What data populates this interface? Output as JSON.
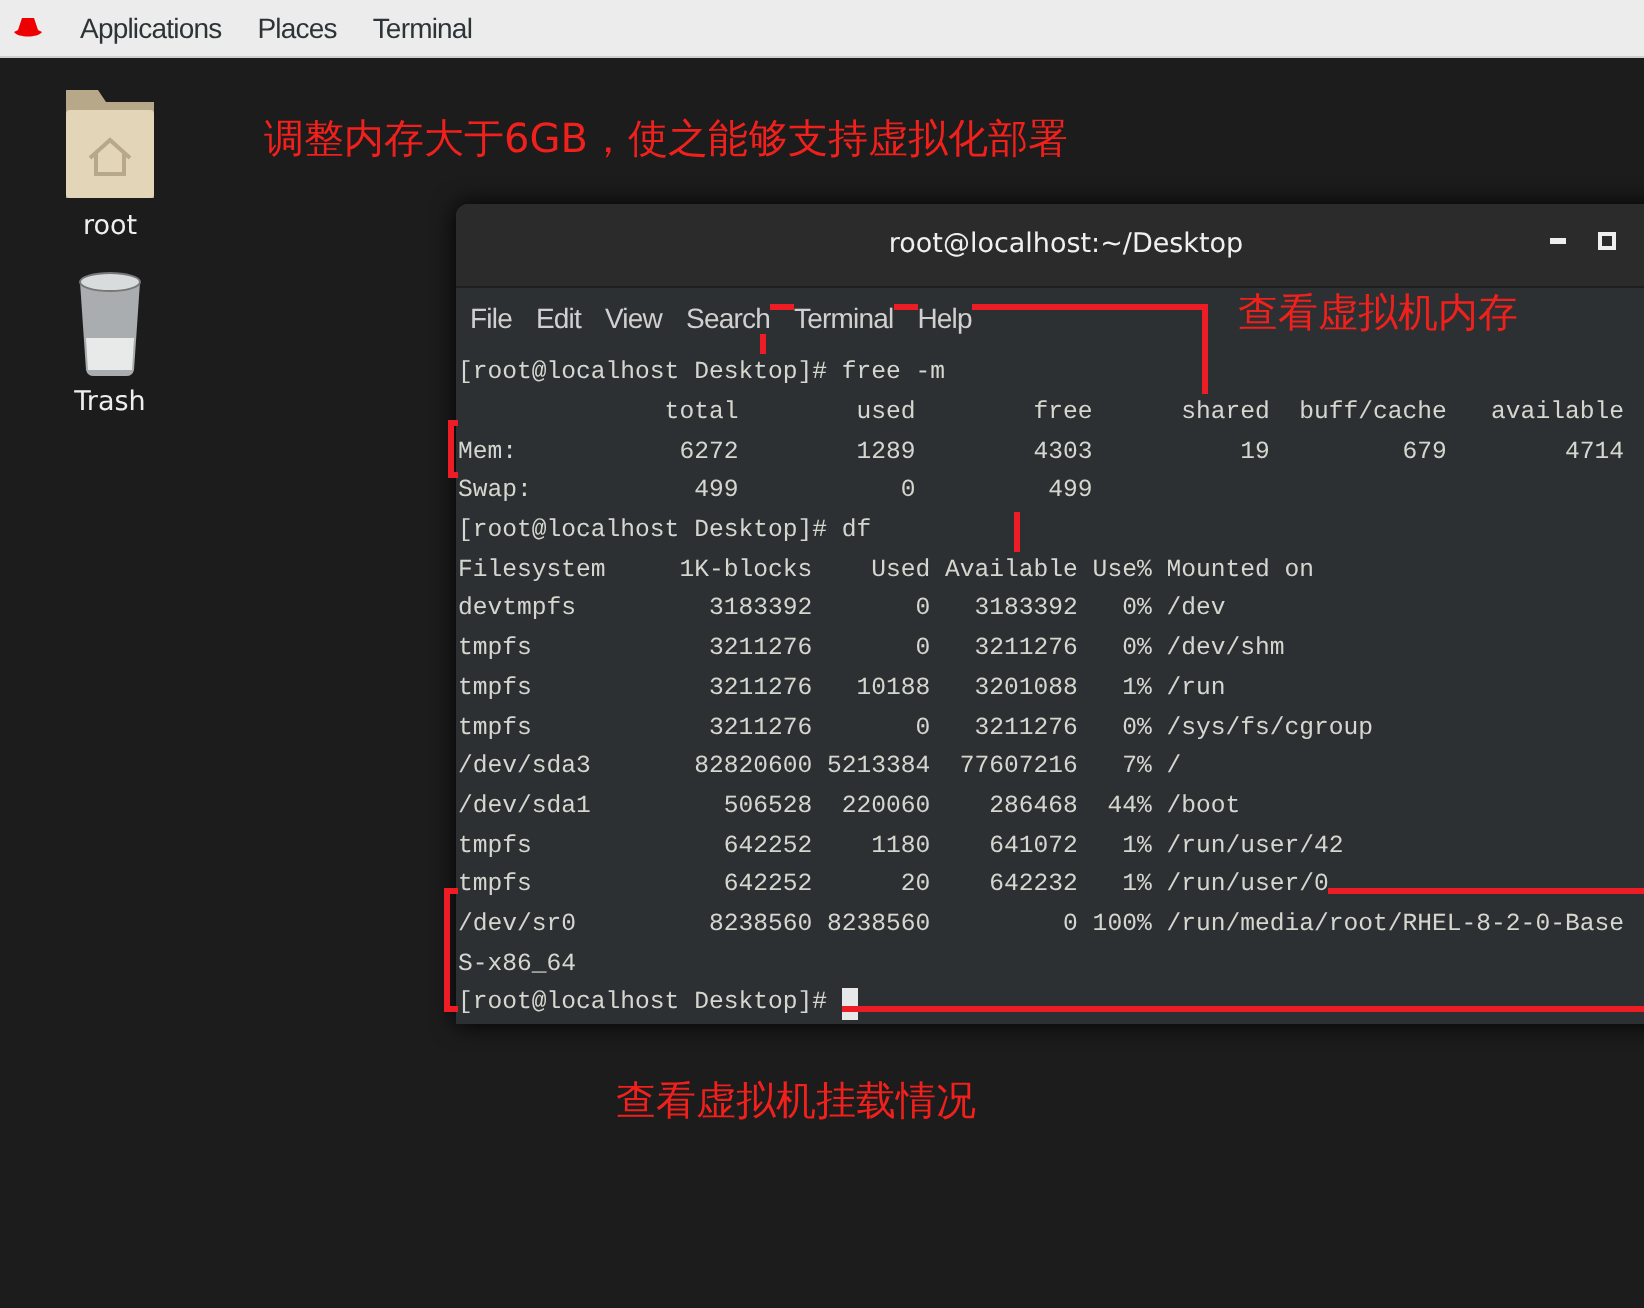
{
  "top_bar": {
    "menus": [
      "Applications",
      "Places",
      "Terminal"
    ]
  },
  "desktop_icons": [
    {
      "label": "root",
      "kind": "folder"
    },
    {
      "label": "Trash",
      "kind": "trash"
    }
  ],
  "terminal": {
    "title": "root@localhost:~/Desktop",
    "menus": [
      "File",
      "Edit",
      "View",
      "Search",
      "Terminal",
      "Help"
    ],
    "cursor": true,
    "lines": [
      "[root@localhost Desktop]# free -m",
      "              total        used        free      shared  buff/cache   available",
      "Mem:           6272        1289        4303          19         679        4714",
      "Swap:           499           0         499",
      "[root@localhost Desktop]# df",
      "Filesystem     1K-blocks    Used Available Use% Mounted on",
      "devtmpfs         3183392       0   3183392   0% /dev",
      "tmpfs            3211276       0   3211276   0% /dev/shm",
      "tmpfs            3211276   10188   3201088   1% /run",
      "tmpfs            3211276       0   3211276   0% /sys/fs/cgroup",
      "/dev/sda3       82820600 5213384  77607216   7% /",
      "/dev/sda1         506528  220060    286468  44% /boot",
      "tmpfs             642252    1180    641072   1% /run/user/42",
      "tmpfs             642252      20    642232   1% /run/user/0",
      "/dev/sr0         8238560 8238560         0 100% /run/media/root/RHEL-8-2-0-Base",
      "S-x86_64",
      "[root@localhost Desktop]# "
    ]
  },
  "annotations": [
    "调整内存大于6GB，使之能够支持虚拟化部署",
    "查看虚拟机内存",
    "查看虚拟机挂载情况"
  ]
}
